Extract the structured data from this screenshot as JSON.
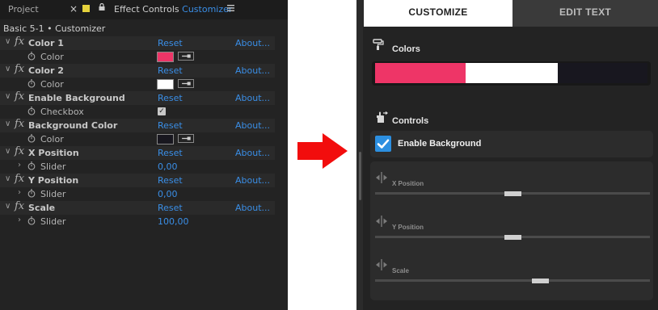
{
  "ae": {
    "tab_project": "Project",
    "tab_effect_controls": "Effect Controls",
    "tab_customizer": "Customizer",
    "comp_title": "Basic 5-1 • Customizer",
    "effects": [
      {
        "name": "Color 1",
        "reset": "Reset",
        "about": "About...",
        "param": "Color",
        "type": "color",
        "color": "#ee3567"
      },
      {
        "name": "Color 2",
        "reset": "Reset",
        "about": "About...",
        "param": "Color",
        "type": "color",
        "color": "#ffffff"
      },
      {
        "name": "Enable Background",
        "reset": "Reset",
        "about": "About...",
        "param": "Checkbox",
        "type": "checkbox",
        "checked": true
      },
      {
        "name": "Background Color",
        "reset": "Reset",
        "about": "About...",
        "param": "Color",
        "type": "color",
        "color": "#18171f"
      },
      {
        "name": "X Position",
        "reset": "Reset",
        "about": "About...",
        "param": "Slider",
        "type": "slider",
        "value": "0,00"
      },
      {
        "name": "Y Position",
        "reset": "Reset",
        "about": "About...",
        "param": "Slider",
        "type": "slider",
        "value": "0,00"
      },
      {
        "name": "Scale",
        "reset": "Reset",
        "about": "About...",
        "param": "Slider",
        "type": "slider",
        "value": "100,00"
      }
    ]
  },
  "customizer": {
    "tabs": {
      "customize": "CUSTOMIZE",
      "edit_text": "EDIT TEXT"
    },
    "colors_title": "Colors",
    "controls_title": "Controls",
    "color_bars": [
      "#ee3567",
      "#ffffff",
      "#18171f"
    ],
    "enable_bg_label": "Enable Background",
    "enable_bg_checked": true,
    "sliders": [
      {
        "label": "X Position",
        "position_fraction": 0.5
      },
      {
        "label": "Y Position",
        "position_fraction": 0.5
      },
      {
        "label": "Scale",
        "position_fraction": 0.6
      }
    ]
  },
  "arrow_color": "#f20d0d"
}
